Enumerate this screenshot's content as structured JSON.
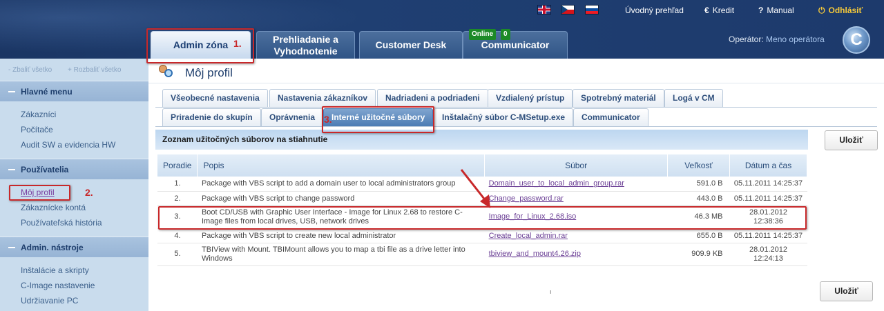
{
  "header": {
    "flags": [
      "english-flag",
      "czech-flag",
      "slovak-flag"
    ],
    "links": {
      "home": "Úvodný prehľad",
      "kredit": "Kredit",
      "manual": "Manual",
      "logout": "Odhlásiť"
    },
    "tabs": [
      {
        "label": "Admin zóna",
        "active": true
      },
      {
        "label": "Prehliadanie a Vyhodnotenie"
      },
      {
        "label": "Customer Desk"
      },
      {
        "label": "Communicator"
      }
    ],
    "online_badge": "Online",
    "online_count": "0",
    "operator_label": "Operátor:",
    "operator_name": "Meno operátora",
    "logo_letter": "C"
  },
  "sidebar": {
    "collapse_all": "- Zbaliť všetko",
    "expand_all": "+ Rozbaliť všetko",
    "sections": [
      {
        "title": "Hlavné menu",
        "items": [
          "Zákazníci",
          "Počítače",
          "Audit SW a evidencia HW"
        ]
      },
      {
        "title": "Používatelia",
        "items": [
          "Môj profil",
          "Zákaznícke kontá",
          "Používateľská história"
        ]
      },
      {
        "title": "Admin. nástroje",
        "items": [
          "Inštalácie a skripty",
          "C-Image nastavenie",
          "Udržiavanie PC"
        ]
      }
    ]
  },
  "page": {
    "title": "Môj profil",
    "subtabs_row1": [
      "Všeobecné nastavenia",
      "Nastavenia zákazníkov",
      "Nadriadeni a podriadeni",
      "Vzdialený prístup",
      "Spotrebný materiál",
      "Logá v CM"
    ],
    "subtabs_row2": [
      "Priradenie do skupín",
      "Oprávnenia",
      "Interné užitočné súbory",
      "Inštalačný súbor C-MSetup.exe",
      "Communicator"
    ],
    "list_title": "Zoznam užitočných súborov na stiahnutie",
    "save_label": "Uložiť",
    "columns": [
      "Poradie",
      "Popis",
      "Súbor",
      "Veľkosť",
      "Dátum a čas"
    ],
    "rows": [
      {
        "n": "1.",
        "desc": "Package with VBS script to add a domain user to local administrators group",
        "file": "Domain_user_to_local_admin_group.rar",
        "size": "591.0 B",
        "date": "05.11.2011 14:25:37"
      },
      {
        "n": "2.",
        "desc": "Package with VBS script to change password",
        "file": "Change_password.rar",
        "size": "443.0 B",
        "date": "05.11.2011 14:25:37"
      },
      {
        "n": "3.",
        "desc": "Boot CD/USB with Graphic User Interface - Image for Linux 2.68 to restore C-Image files from local drives, USB, network drives",
        "file": "Image_for_Linux_2.68.iso",
        "size": "46.3 MB",
        "date": "28.01.2012 12:38:36"
      },
      {
        "n": "4.",
        "desc": "Package with VBS script to create new local administrator",
        "file": "Create_local_admin.rar",
        "size": "655.0 B",
        "date": "05.11.2011 14:25:37"
      },
      {
        "n": "5.",
        "desc": "TBIView with Mount. TBIMount allows you to map a tbi file as a drive letter into Windows",
        "file": "tbiview_and_mount4.26.zip",
        "size": "909.9 KB",
        "date": "28.01.2012 12:24:13"
      }
    ]
  },
  "annotations": {
    "step1": "1.",
    "step2": "2.",
    "step3": "3.",
    "color": "#c8282a"
  }
}
